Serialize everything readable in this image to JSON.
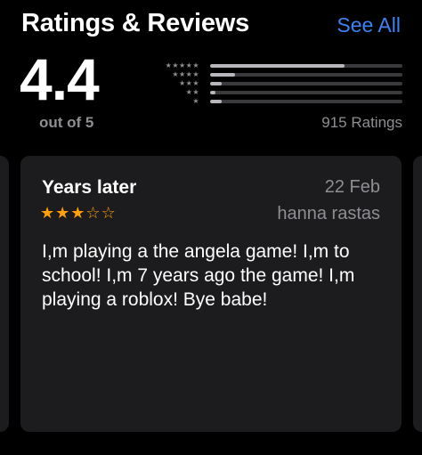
{
  "header": {
    "title": "Ratings & Reviews",
    "see_all_label": "See All"
  },
  "summary": {
    "average": "4.4",
    "out_of": "out of 5",
    "ratings_count": "915 Ratings",
    "histogram": [
      {
        "stars": "★★★★★",
        "fraction": 0.7
      },
      {
        "stars": "★★★★",
        "fraction": 0.13
      },
      {
        "stars": "★★★",
        "fraction": 0.06
      },
      {
        "stars": "★★",
        "fraction": 0.03
      },
      {
        "stars": "★",
        "fraction": 0.06
      }
    ]
  },
  "review": {
    "title": "Years later",
    "date": "22 Feb",
    "author": "hanna rastas",
    "rating": 3,
    "max_rating": 5,
    "body": "I,m playing a the angela game! I,m to school! I,m 7 years ago the game! I,m playing a roblox! Bye babe!"
  },
  "colors": {
    "accent": "#3b82f6",
    "star": "#ff9f0a",
    "card_background": "#1c1c1e",
    "secondary_text": "#8e8e93"
  }
}
